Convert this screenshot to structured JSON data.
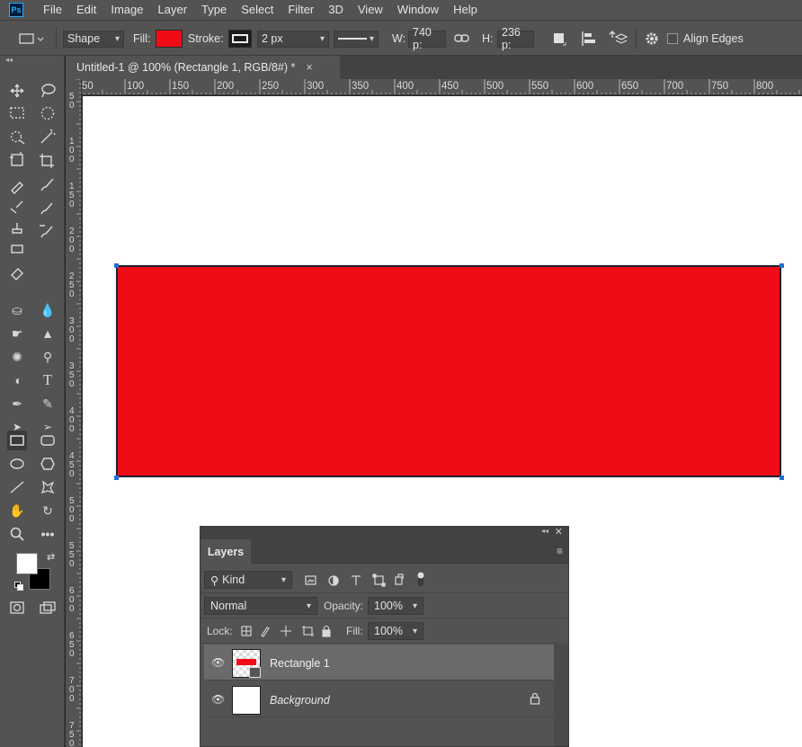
{
  "menu": {
    "logo": "Ps",
    "items": [
      "File",
      "Edit",
      "Image",
      "Layer",
      "Type",
      "Select",
      "Filter",
      "3D",
      "View",
      "Window",
      "Help"
    ]
  },
  "options": {
    "mode_value": "Shape",
    "fill_label": "Fill:",
    "fill_color": "#f00c17",
    "stroke_label": "Stroke:",
    "stroke_width": "2 px",
    "w_label": "W:",
    "w_value": "740 p:",
    "h_label": "H:",
    "h_value": "236 p:",
    "align_edges_label": "Align Edges"
  },
  "document": {
    "tab_title": "Untitled-1 @ 100% (Rectangle 1, RGB/8#) *",
    "close_glyph": "×"
  },
  "ruler": {
    "h_labels": [
      "50",
      "100",
      "150",
      "200",
      "250",
      "300",
      "350",
      "400",
      "450",
      "500",
      "550",
      "600",
      "650",
      "700",
      "750",
      "800"
    ],
    "v_labels": [
      "5\n0",
      "1\n0\n0",
      "1\n5\n0",
      "2\n0\n0",
      "2\n5\n0",
      "3\n0\n0",
      "3\n5\n0",
      "4\n0\n0",
      "4\n5\n0",
      "5\n0\n0",
      "5\n5\n0",
      "6\n0\n0",
      "6\n5\n0",
      "7\n0\n0",
      "7\n5\n0"
    ]
  },
  "canvas": {
    "rect_fill": "#f00c17",
    "rect_stroke": "#1f1f30"
  },
  "layers_panel": {
    "tab_label": "Layers",
    "kind_value": "Kind",
    "blend_mode": "Normal",
    "opacity_label": "Opacity:",
    "opacity_value": "100%",
    "lock_label": "Lock:",
    "fill_label": "Fill:",
    "fill_value": "100%",
    "layers": [
      {
        "name": "Rectangle 1",
        "italic": false,
        "selected": true
      },
      {
        "name": "Background",
        "italic": true,
        "selected": false
      }
    ]
  },
  "colors": {
    "foreground": "#ffffff",
    "background": "#000000",
    "accent": "#31a8ff"
  }
}
